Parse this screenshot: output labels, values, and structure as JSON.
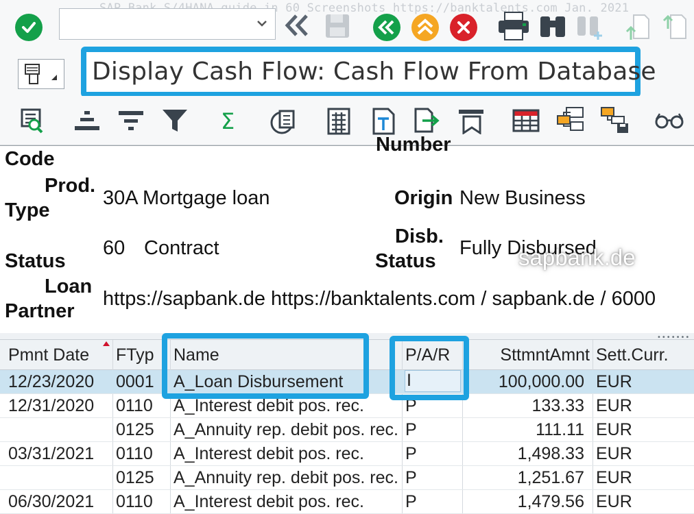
{
  "window": {
    "watermark": "SAP Bank S/4HANA guide in 60 Screenshots  https://banktalents.com Jan. 2021",
    "title": "Display Cash Flow: Cash Flow From Database"
  },
  "toolbar": {
    "command_placeholder": "",
    "icons": [
      "enter-icon",
      "back-double-chevron-icon",
      "save-icon",
      "back-icon",
      "exit-icon",
      "cancel-icon",
      "print-icon",
      "find-icon",
      "find-next-icon",
      "first-page-icon",
      "last-page-icon"
    ]
  },
  "app_toolbar": {
    "icons": [
      "details-icon",
      "sort-ascending-icon",
      "sort-descending-icon",
      "filter-icon",
      "total-icon",
      "subtotals-icon",
      "calculator-icon",
      "text-icon",
      "export-icon",
      "print-preview-icon",
      "layout-icon",
      "select-layout-icon",
      "save-layout-icon",
      "glasses-icon"
    ],
    "total_glyph": "Σ"
  },
  "header": {
    "number_partial": "Number",
    "code_label": "Code",
    "prod_type_label_1": "Prod.",
    "prod_type_label_2": "Type",
    "prod_type_value": "30A Mortgage loan",
    "origin_label": "Origin",
    "origin_value": "New Business",
    "status_label": "Status",
    "status_code": "60",
    "status_text": "Contract",
    "disb_status_label_1": "Disb.",
    "disb_status_label_2": "Status",
    "disb_status_value": "Fully Disbursed",
    "loan_partner_label_1": "Loan",
    "loan_partner_label_2": "Partner",
    "loan_partner_value": "https://sapbank.de https://banktalents.com / sapbank.de / 6000",
    "watermark": "sapbank.de"
  },
  "table": {
    "columns": [
      "Pmnt Date",
      "FTyp",
      "Name",
      "P/A/R",
      "SttmntAmnt",
      "Sett.Curr."
    ],
    "rows": [
      {
        "date": "12/23/2020",
        "ftyp": "0001",
        "name": "A_Loan Disbursement",
        "par": "I",
        "amount": "100,000.00",
        "curr": "EUR",
        "selected": true
      },
      {
        "date": "12/31/2020",
        "ftyp": "0110",
        "name": "A_Interest debit pos. rec.",
        "par": "P",
        "amount": "133.33",
        "curr": "EUR"
      },
      {
        "date": "",
        "ftyp": "0125",
        "name": "A_Annuity rep. debit pos. rec.",
        "par": "P",
        "amount": "111.11",
        "curr": "EUR"
      },
      {
        "date": "03/31/2021",
        "ftyp": "0110",
        "name": "A_Interest debit pos. rec.",
        "par": "P",
        "amount": "1,498.33",
        "curr": "EUR"
      },
      {
        "date": "",
        "ftyp": "0125",
        "name": "A_Annuity rep. debit pos. rec.",
        "par": "P",
        "amount": "1,251.67",
        "curr": "EUR"
      },
      {
        "date": "06/30/2021",
        "ftyp": "0110",
        "name": "A_Interest debit pos. rec.",
        "par": "P",
        "amount": "1,479.56",
        "curr": "EUR"
      }
    ]
  },
  "colors": {
    "highlight": "#1ea2e0",
    "enter_green": "#14a04a",
    "cancel_red": "#d9222a",
    "exit_orange": "#f5a623",
    "selected_row": "#cbe3f1"
  }
}
